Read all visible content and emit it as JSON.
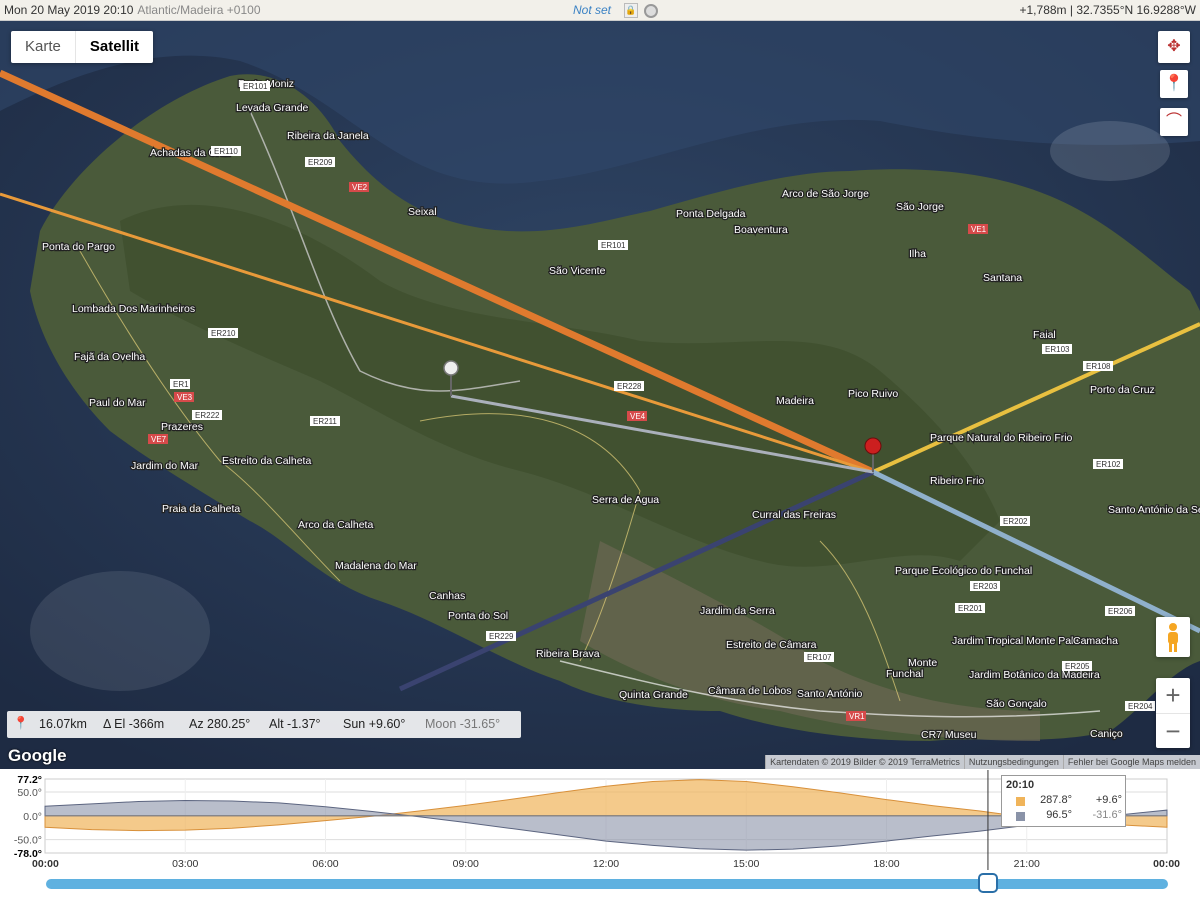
{
  "topbar": {
    "datetime": "Mon 20 May 2019 20:10",
    "timezone": "Atlantic/Madeira +0100",
    "not_set": "Not set",
    "coords": "+1,788m | 32.7355°N 16.9288°W"
  },
  "map": {
    "type_options": [
      "Karte",
      "Satellit"
    ],
    "active_type": "Satellit",
    "labels": [
      "Porto Moniz",
      "Levada Grande",
      "Ribeira da Janela",
      "Achadas da Cruz",
      "Seixal",
      "Ponta Delgada",
      "Arco de São Jorge",
      "São Jorge",
      "Boaventura",
      "São Vicente",
      "Ponta do Pargo",
      "Lombada Dos Marinheiros",
      "Fajã da Ovelha",
      "Paul do Mar",
      "Prazeres",
      "Jardim do Mar",
      "Estreito da Calheta",
      "Praia da Calheta",
      "Arco da Calheta",
      "Madalena do Mar",
      "Canhas",
      "Ponta do Sol",
      "Ribeira Brava",
      "Serra de Agua",
      "Curral das Freiras",
      "Madeira",
      "Pico Ruivo",
      "Ilha",
      "Santana",
      "Faial",
      "Porto da Cruz",
      "Parque Natural do Ribeiro Frio",
      "Ribeiro Frio",
      "Santo António da Serra",
      "Parque Ecológico do Funchal",
      "Jardim da Serra",
      "Estreito de Câmara",
      "Quinta Grande",
      "Câmara de Lobos",
      "Santo António",
      "Funchal",
      "Monte",
      "Jardim Tropical Monte Palace",
      "Jardim Botânico da Madeira",
      "São Gonçalo",
      "Camacha",
      "Caniço",
      "CR7 Museu"
    ],
    "roads": [
      "ER101",
      "ER110",
      "ER209",
      "VE2",
      "ER228",
      "VE4",
      "ER210",
      "ER222",
      "ER211",
      "VE3",
      "VE7",
      "ER1",
      "ER101",
      "VE1",
      "ER103",
      "ER108",
      "ER102",
      "ER202",
      "ER203",
      "ER201",
      "ER205",
      "ER206",
      "ER204",
      "VR1",
      "ER107",
      "ER229"
    ]
  },
  "info": {
    "distance": "16.07km",
    "delta_el": "Δ El  -366m",
    "azimuth": "Az 280.25°",
    "altitude": "Alt  -1.37°",
    "sun": "Sun +9.60°",
    "moon": "Moon -31.65°"
  },
  "google_logo": "Google",
  "attribution": [
    "Kartendaten © 2019 Bilder © 2019 TerraMetrics",
    "Nutzungsbedingungen",
    "Fehler bei Google Maps melden"
  ],
  "chart_data": {
    "type": "area",
    "x": [
      "00:00",
      "03:00",
      "06:00",
      "09:00",
      "12:00",
      "15:00",
      "18:00",
      "21:00",
      "00:00"
    ],
    "x_label_first": "00:00",
    "x_label_last": "00:00",
    "y_ticks": [
      "77.2°",
      "50.0°",
      "0.0°",
      "-50.0°",
      "-78.0°"
    ],
    "ylim": [
      -78.0,
      77.2
    ],
    "hours": [
      0,
      1,
      2,
      3,
      4,
      5,
      6,
      7,
      8,
      9,
      10,
      11,
      12,
      13,
      14,
      15,
      16,
      17,
      18,
      19,
      20,
      21,
      22,
      23,
      24
    ],
    "series": [
      {
        "name": "Sun",
        "color": "#f0b45a",
        "values": [
          -24,
          -29,
          -31,
          -30,
          -26,
          -19,
          -10,
          -1,
          10,
          22,
          35,
          49,
          62,
          72,
          76,
          72,
          61,
          48,
          34,
          21,
          10,
          -3,
          -12,
          -19,
          -24
        ]
      },
      {
        "name": "Moon",
        "color": "#8a93a8",
        "values": [
          20,
          25,
          30,
          32,
          31,
          27,
          19,
          9,
          -2,
          -14,
          -27,
          -40,
          -53,
          -62,
          -69,
          -72,
          -70,
          -63,
          -53,
          -42,
          -32,
          -20,
          -8,
          2,
          12
        ]
      }
    ],
    "cursor_hour": 20.17,
    "tooltip": {
      "time": "20:10",
      "sun_az": "287.8°",
      "sun_alt": "+9.6°",
      "moon_az": "96.5°",
      "moon_alt": "-31.6°"
    }
  }
}
